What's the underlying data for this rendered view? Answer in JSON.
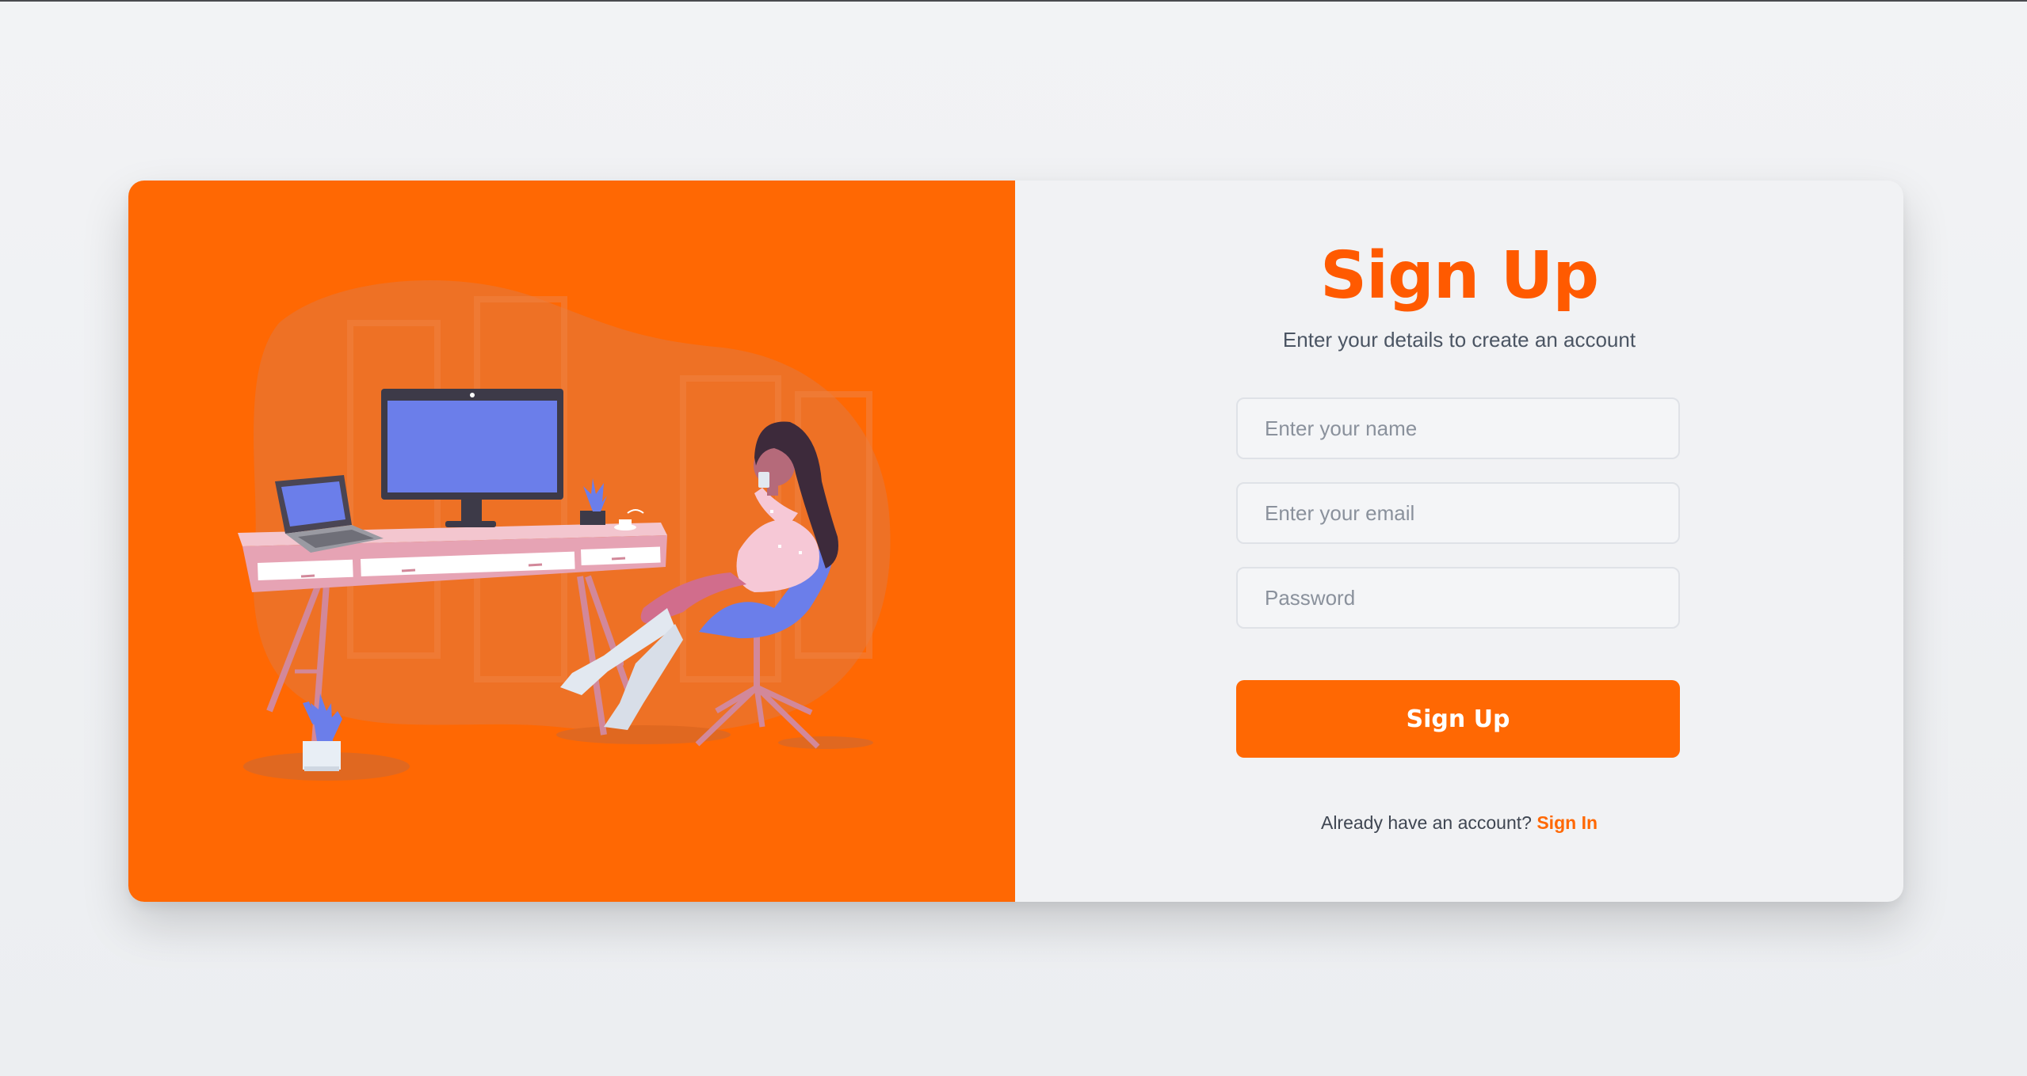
{
  "colors": {
    "accent": "#ff6803",
    "title": "#ff5a00",
    "panel_bg": "#ff6803",
    "card_bg": "#f1f2f4"
  },
  "illustration": {
    "icon": "woman-at-desk-illustration"
  },
  "form": {
    "title": "Sign Up",
    "subtitle": "Enter your details to create an account",
    "name_placeholder": "Enter your name",
    "email_placeholder": "Enter your email",
    "password_placeholder": "Password",
    "name_value": "",
    "email_value": "",
    "password_value": "",
    "submit_label": "Sign Up",
    "signin_prompt": "Already have an account?",
    "signin_link": "Sign In"
  }
}
